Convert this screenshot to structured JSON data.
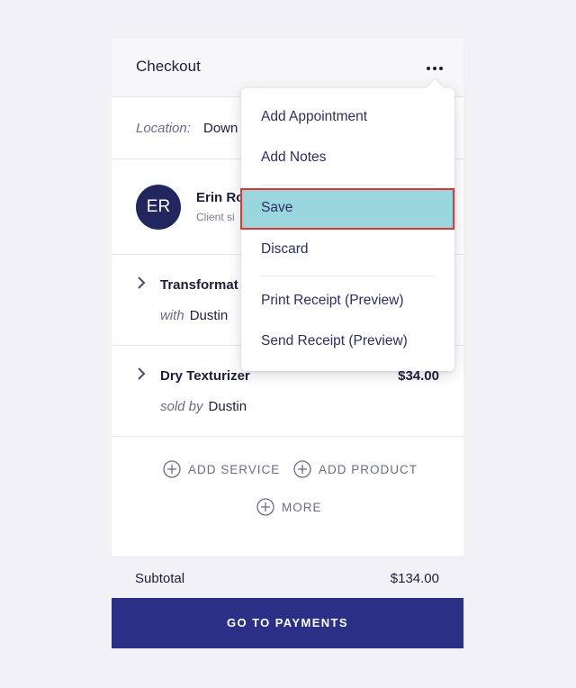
{
  "header": {
    "title": "Checkout"
  },
  "location": {
    "label": "Location:",
    "value": "Down"
  },
  "client": {
    "initials": "ER",
    "name": "Erin Ro",
    "subtitle": "Client si"
  },
  "items": [
    {
      "name": "Transformat",
      "price": "",
      "by_label": "with",
      "by_name": "Dustin"
    },
    {
      "name": "Dry Texturizer",
      "price": "$34.00",
      "by_label": "sold by",
      "by_name": "Dustin"
    }
  ],
  "actions": {
    "add_service": "ADD SERVICE",
    "add_product": "ADD PRODUCT",
    "more": "MORE"
  },
  "subtotal": {
    "label": "Subtotal",
    "value": "$134.00"
  },
  "cta": {
    "label": "GO TO PAYMENTS"
  },
  "menu": {
    "items": [
      "Add Appointment",
      "Add Notes",
      "Save",
      "Discard",
      "Print Receipt (Preview)",
      "Send Receipt (Preview)"
    ],
    "selected": "Save"
  },
  "colors": {
    "primary": "#2b2f86",
    "avatar": "#22265e",
    "highlight": "#9ad6de",
    "highlight_border": "#e2352b"
  }
}
